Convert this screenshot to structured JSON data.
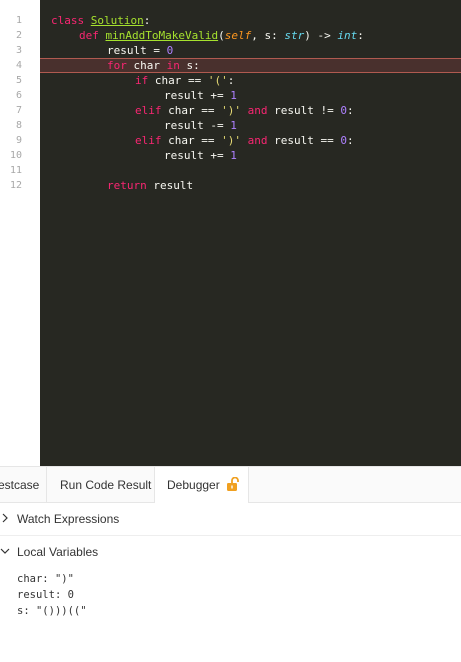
{
  "editor": {
    "line_numbers": [
      "1",
      "2",
      "3",
      "4",
      "5",
      "6",
      "7",
      "8",
      "9",
      "10",
      "11",
      "12"
    ],
    "current_line": 4,
    "code": {
      "l1": {
        "kw": "class ",
        "name": "Solution",
        "rest": ":"
      },
      "l2": {
        "kw": "def ",
        "name": "minAddToMakeValid",
        "p1": "(",
        "self": "self",
        "p2": ", s: ",
        "type1": "str",
        "p3": ") -> ",
        "type2": "int",
        "p4": ":"
      },
      "l3": {
        "text": "result = ",
        "num": "0"
      },
      "l4": {
        "kw1": "for",
        "t1": " char ",
        "kw2": "in",
        "t2": " s:"
      },
      "l5": {
        "kw": "if",
        "t1": " char == ",
        "str": "'('",
        "t2": ":"
      },
      "l6": {
        "text": "result += ",
        "num": "1"
      },
      "l7": {
        "kw": "elif",
        "t1": " char == ",
        "str": "')'",
        "t2": " ",
        "kw2": "and",
        "t3": " result != ",
        "num": "0",
        "t4": ":"
      },
      "l8": {
        "text": "result -= ",
        "num": "1"
      },
      "l9": {
        "kw": "elif",
        "t1": " char == ",
        "str": "')'",
        "t2": " ",
        "kw2": "and",
        "t3": " result == ",
        "num": "0",
        "t4": ":"
      },
      "l10": {
        "text": "result += ",
        "num": "1"
      },
      "l12": {
        "kw": "return",
        "t1": " result"
      }
    }
  },
  "tabs": {
    "testcase": "Testcase",
    "run_result": "Run Code Result",
    "debugger": "Debugger"
  },
  "sections": {
    "watch": "Watch Expressions",
    "locals": "Local Variables"
  },
  "locals": [
    {
      "name": "char",
      "value": "\")\""
    },
    {
      "name": "result",
      "value": "0"
    },
    {
      "name": "s",
      "value": "\"()))((\""
    }
  ],
  "colors": {
    "editor_bg": "#272822",
    "current_line_bg": "#49302d",
    "keyword": "#f92672",
    "function": "#a6e22e",
    "type": "#66d9ef",
    "number": "#ae81ff",
    "string": "#e6db74",
    "lock_icon": "#f0a020"
  }
}
